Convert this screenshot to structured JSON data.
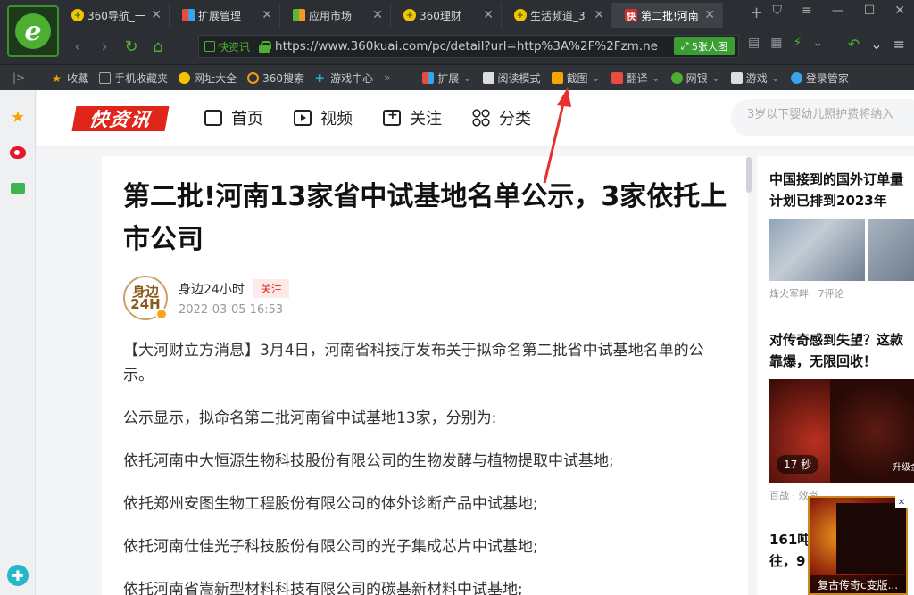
{
  "browser": {
    "tabs": [
      {
        "label": "360导航_一",
        "icon": "360-icon"
      },
      {
        "label": "扩展管理",
        "icon": "extension-icon"
      },
      {
        "label": "应用市场",
        "icon": "app-market-icon"
      },
      {
        "label": "360理财",
        "icon": "360-icon"
      },
      {
        "label": "生活频道_3",
        "icon": "360-icon"
      },
      {
        "label": "第二批!河南",
        "icon": "kuaizixun-icon"
      }
    ],
    "address": {
      "badge": "快资讯",
      "url": "https://www.360kuai.com/pc/detail?url=http%3A%2F%2Fzm.ne",
      "big_image_button": "5张大图"
    },
    "bookmarks": [
      {
        "label": "收藏",
        "icon": "star-icon",
        "color": "#f7a600"
      },
      {
        "label": "手机收藏夹",
        "icon": "phone-icon",
        "color": "#aaaaaa"
      },
      {
        "label": "网址大全",
        "icon": "360-icon",
        "color": "#f5c400"
      },
      {
        "label": "360搜索",
        "icon": "search-logo-icon",
        "color": "#f29b1d"
      },
      {
        "label": "游戏中心",
        "icon": "game-icon",
        "color": "#27b7c9"
      }
    ],
    "toolbar_items": [
      {
        "label": "扩展",
        "icon": "extension-icon",
        "color": "#e84c3d"
      },
      {
        "label": "阅读模式",
        "icon": "book-icon",
        "color": "#dddddd"
      },
      {
        "label": "截图",
        "icon": "screenshot-icon",
        "color": "#f7a600"
      },
      {
        "label": "翻译",
        "icon": "translate-icon",
        "color": "#e84c3d"
      },
      {
        "label": "网银",
        "icon": "shield-icon",
        "color": "#4caf2f"
      },
      {
        "label": "游戏",
        "icon": "gamepad-icon",
        "color": "#dddddd"
      },
      {
        "label": "登录管家",
        "icon": "key-icon",
        "color": "#3aa3ea"
      }
    ]
  },
  "site": {
    "logo": "快资讯",
    "nav": [
      {
        "label": "首页",
        "icon": "home-icon"
      },
      {
        "label": "视频",
        "icon": "video-icon"
      },
      {
        "label": "关注",
        "icon": "follow-icon"
      },
      {
        "label": "分类",
        "icon": "category-icon"
      }
    ],
    "search_hint": "3岁以下婴幼儿照护费将纳入"
  },
  "article": {
    "title": "第二批!河南13家省中试基地名单公示，3家依托上市公司",
    "author": {
      "name": "身边24小时",
      "follow": "关注",
      "time": "2022-03-05 16:53",
      "avatar_text": "身边 24H"
    },
    "paragraphs": [
      "【大河财立方消息】3月4日，河南省科技厅发布关于拟命名第二批省中试基地名单的公示。",
      "公示显示，拟命名第二批河南省中试基地13家，分别为:",
      "依托河南中大恒源生物科技股份有限公司的生物发酵与植物提取中试基地;",
      "依托郑州安图生物工程股份有限公司的体外诊断产品中试基地;",
      "依托河南仕佳光子科技股份有限公司的光子集成芯片中试基地;",
      "依托河南省嵩新型材料科技有限公司的碳基新材料中试基地;"
    ]
  },
  "sidebar_news": [
    {
      "title_lines": [
        "中国接到的国外订单量",
        "计划已排到2023年"
      ],
      "source": "烽火军畔",
      "comments": "7评论"
    },
    {
      "title_lines": [
        "对传奇感到失望？这款",
        "靠爆，无限回收！"
      ],
      "source": "百战 · 效尚",
      "duration": "17 秒",
      "badge": "升级金"
    },
    {
      "title_lines": [
        "161吨",
        "往，9"
      ]
    }
  ],
  "float_ad": {
    "caption": "复古传奇c变版..."
  }
}
